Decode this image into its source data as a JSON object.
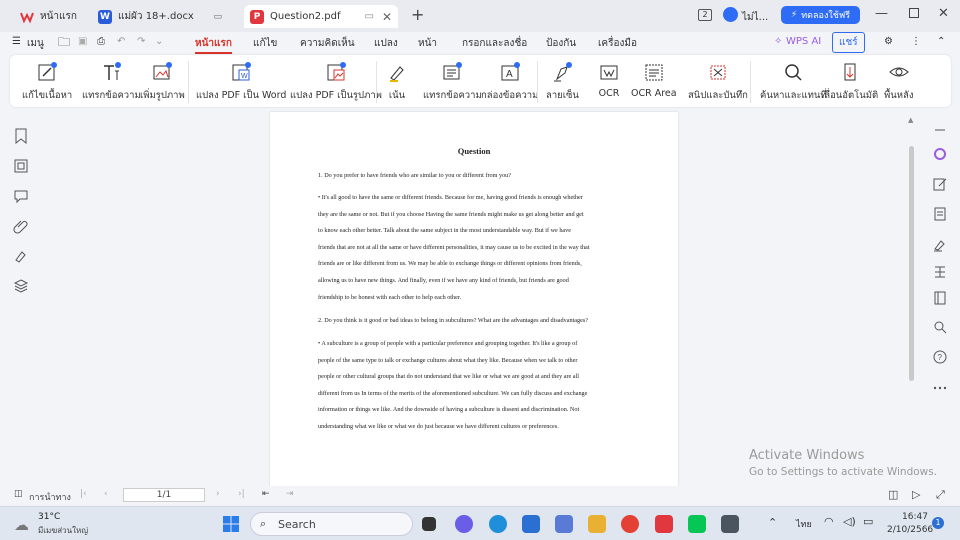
{
  "tabs": [
    {
      "label": "หน้าแรก",
      "icon": "wps-logo-icon"
    },
    {
      "label": "แม่ผัว 18+.docx",
      "icon": "word-doc-icon"
    },
    {
      "label": "Question2.pdf",
      "icon": "pdf-icon"
    }
  ],
  "window": {
    "badge": "2",
    "user": "ไม่ไ...",
    "trial_button": "ทดลองใช้ฟรี"
  },
  "menu": {
    "menu_label": "เมนู",
    "items": [
      "หน้าแรก",
      "แก้ไข",
      "ความคิดเห็น",
      "แปลง",
      "หน้า",
      "กรอกและลงชื่อ",
      "ป้องกัน",
      "เครื่องมือ"
    ],
    "active": "หน้าแรก",
    "wps_ai": "WPS AI",
    "share": "แชร์"
  },
  "ribbon": [
    "แก้ไขเนื้อหา",
    "แทรกข้อความ",
    "เพิ่มรูปภาพ",
    "แปลง PDF เป็น Word",
    "แปลง PDF เป็นรูปภาพ",
    "เน้น",
    "แทรกข้อความ",
    "กล่องข้อความ",
    "ลายเซ็น",
    "OCR",
    "OCR Area",
    "สนิปและบันทึก",
    "ค้นหาและแทนที่",
    "เลื่อนอัตโนมัติ",
    "พื้นหลัง"
  ],
  "document": {
    "title": "Question",
    "q1": "1. Do you prefer to have friends who are similar to you or different from you?",
    "a1": "• It's all good to have the same or different friends.  Because for me, having good friends is enough whether\nthey are the same or not.  But if you choose  Having the same friends might make us get along better and get\nto know each other better.  Talk about the same subject in the most understandable way.  But if we have\nfriends that are not at all the same or have different personalities, it may cause us to be excited in the way that\nfriends are or like different from us.  We may be able to exchange things or different opinions from friends,\nallowing us to have new things.  And finally, even if we have any kind of friends, but friends are good\nfriendship to be honest with each other to help each other.",
    "q2": "2. Do you think is it good or bad ideas to  belong in subcultures? What are the advantages and disadvantages?",
    "a2": " • A subculture is a group of people with a particular preference and grouping together.  It's like a group of\npeople of the same type to talk or exchange cultures about what they like.  Because when we talk to other\npeople or other cultural groups that do not understand  that we like or what we are good at and they are all\ndifferent from us  In terms of the merits of the aforementioned subculture.  We can fully discuss and exchange\ninformation or things we like.  And the downside of having a subculture is dissent and discrimination.  Not\nunderstanding what we like or what we do just because we have different cultures or preferences."
  },
  "watermark": {
    "line1": "Activate Windows",
    "line2": "Go to Settings to activate Windows."
  },
  "status": {
    "nav_label": "การนำทาง",
    "page": "1/1"
  },
  "taskbar": {
    "temp": "31°C",
    "weather": "มีเมฆส่วนใหญ่",
    "search": "Search",
    "lang": "ไทย",
    "time": "16:47",
    "date": "2/10/2566",
    "notif": "1"
  },
  "colors": {
    "accent_red": "#d9342b",
    "wps_blue": "#2f6cf6",
    "word_blue": "#2b5cd8",
    "pdf_red": "#e0383e"
  }
}
